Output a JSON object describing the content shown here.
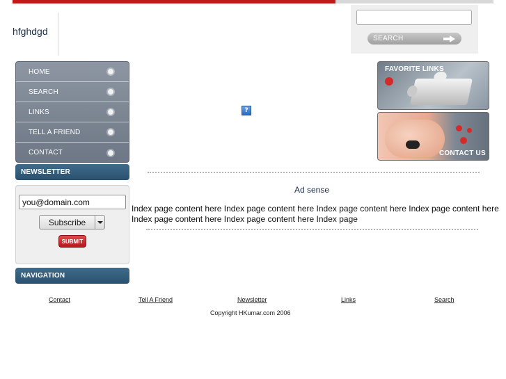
{
  "header": {
    "site_title": "hfghdgd",
    "search": {
      "value": "",
      "button_label": "SEARCH"
    }
  },
  "menu": {
    "items": [
      {
        "label": "HOME"
      },
      {
        "label": "SEARCH"
      },
      {
        "label": "LINKS"
      },
      {
        "label": "TELL A FRIEND"
      },
      {
        "label": "CONTACT"
      }
    ]
  },
  "newsletter": {
    "heading": "NEWSLETTER",
    "email_value": "you@domain.com",
    "select_value": "Subscribe",
    "submit_label": "SUBMIT"
  },
  "navigation": {
    "heading": "NAVIGATION"
  },
  "promos": {
    "favorite_links_label": "FAVORITE LINKS",
    "contact_us_label": "CONTACT US"
  },
  "main": {
    "ad_label": "Ad sense",
    "content": "Index page content here Index page content here Index page content here Index page content here Index page content here Index page content here Index page"
  },
  "footer": {
    "links": [
      "Contact",
      "Tell A Friend",
      "Newsletter",
      "Links",
      "Search"
    ],
    "copyright": "Copyright HKumar.com 2006"
  },
  "colors": {
    "accent_red": "#c0181c",
    "menu_gray": "#7d8794",
    "section_blue": "#2f5a79"
  }
}
